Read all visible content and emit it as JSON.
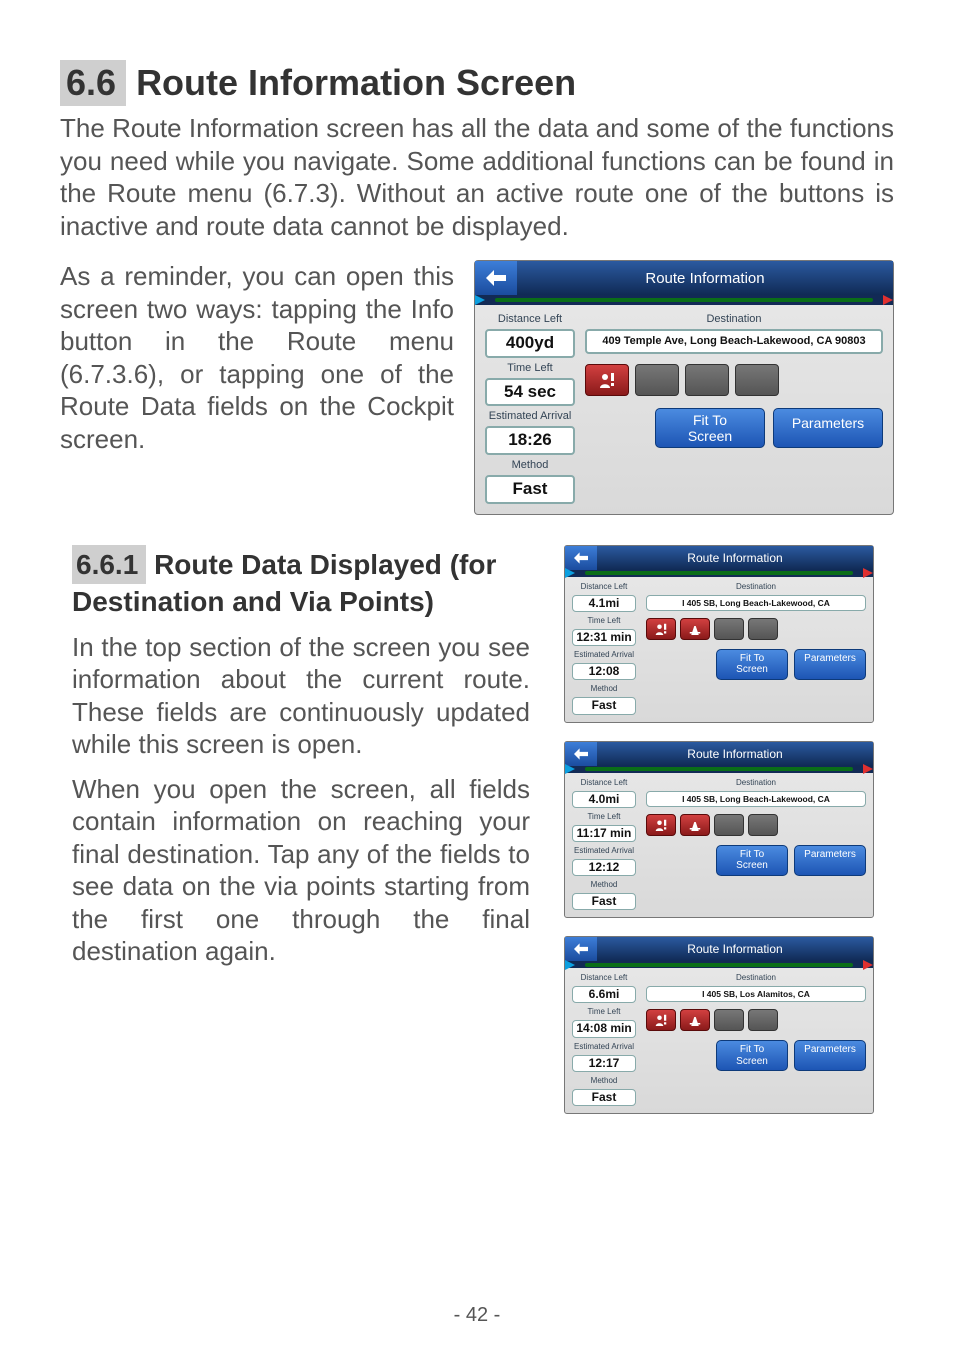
{
  "section": {
    "num": "6.6",
    "title": "Route Information Screen"
  },
  "intro": "The Route Information screen has all the data and some of the functions you need while you navigate. Some additional functions can be found in the Route menu (6.7.3). Without an active route one of the buttons is inactive and route data cannot be displayed.",
  "reminder": "As a reminder, you can open this screen two ways: tapping the Info button in the Route menu (6.7.3.6), or tapping one of the Route Data fields on the Cockpit screen.",
  "subsection": {
    "num": "6.6.1",
    "title_rest": "Route Data Displayed (for Destination and Via Points)"
  },
  "sub_p1": "In the top section of the screen you see information about the current route. These fields are continuously updated while this screen is open.",
  "sub_p2": "When you open the screen, all fields contain information on reaching your final destination. Tap any of the fields to see data on the via points starting from the first one through the final destination again.",
  "page_num": "- 42 -",
  "labels": {
    "title": "Route Information",
    "distance_left": "Distance Left",
    "destination": "Destination",
    "time_left": "Time Left",
    "estimated_arrival": "Estimated Arrival",
    "method": "Method"
  },
  "buttons": {
    "fit_line1": "Fit To",
    "fit_line2": "Screen",
    "parameters": "Parameters"
  },
  "large": {
    "distance": "400yd",
    "destination": "409 Temple Ave, Long Beach-Lakewood, CA 90803",
    "time_left": "54 sec",
    "eta": "18:26",
    "method": "Fast"
  },
  "small": [
    {
      "distance": "4.1mi",
      "destination": "I 405 SB, Long Beach-Lakewood, CA",
      "time_left": "12:31 min",
      "eta": "12:08",
      "method": "Fast"
    },
    {
      "distance": "4.0mi",
      "destination": "I 405 SB, Long Beach-Lakewood, CA",
      "time_left": "11:17 min",
      "eta": "12:12",
      "method": "Fast"
    },
    {
      "distance": "6.6mi",
      "destination": "I 405 SB, Los Alamitos, CA",
      "time_left": "14:08 min",
      "eta": "12:17",
      "method": "Fast"
    }
  ]
}
